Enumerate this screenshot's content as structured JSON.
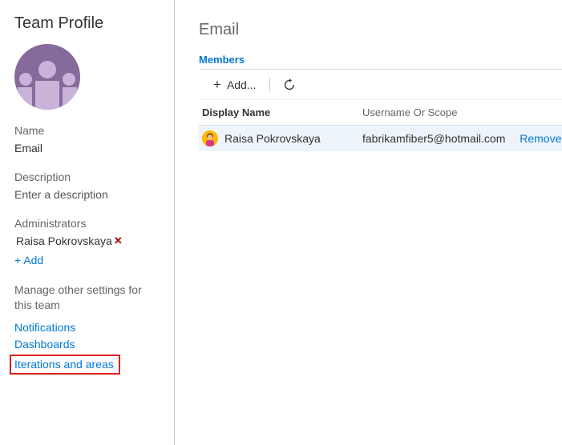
{
  "sidebar": {
    "title": "Team Profile",
    "name_label": "Name",
    "name_value": "Email",
    "description_label": "Description",
    "description_placeholder": "Enter a description",
    "admins_label": "Administrators",
    "admins": [
      {
        "name": "Raisa Pokrovskaya"
      }
    ],
    "add_label": "+ Add",
    "manage_heading": "Manage other settings for this team",
    "links": {
      "notifications": "Notifications",
      "dashboards": "Dashboards",
      "iterations": "Iterations and areas"
    }
  },
  "main": {
    "title": "Email",
    "members_tab": "Members",
    "toolbar": {
      "add_label": "Add..."
    },
    "table": {
      "col_display": "Display Name",
      "col_user": "Username Or Scope",
      "rows": [
        {
          "display": "Raisa Pokrovskaya",
          "user": "fabrikamfiber5@hotmail.com",
          "action": "Remove"
        }
      ]
    }
  }
}
